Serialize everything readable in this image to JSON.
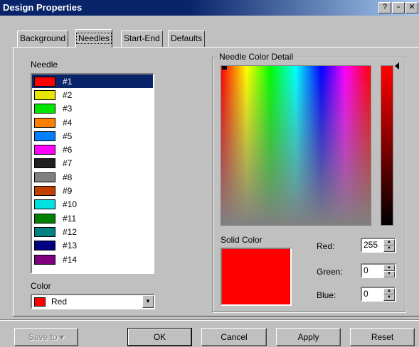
{
  "window": {
    "title": "Design Properties",
    "controls": [
      "help-icon",
      "restore-icon",
      "close-icon"
    ]
  },
  "tabs": [
    {
      "label": "Background"
    },
    {
      "label": "Needles"
    },
    {
      "label": "Start-End"
    },
    {
      "label": "Defaults"
    }
  ],
  "needle_section": {
    "label": "Needle",
    "items": [
      {
        "label": "#1",
        "color": "#ff0000"
      },
      {
        "label": "#2",
        "color": "#e6e600"
      },
      {
        "label": "#3",
        "color": "#00e600"
      },
      {
        "label": "#4",
        "color": "#ff8000"
      },
      {
        "label": "#5",
        "color": "#0080ff"
      },
      {
        "label": "#6",
        "color": "#ff00ff"
      },
      {
        "label": "#7",
        "color": "#202020"
      },
      {
        "label": "#8",
        "color": "#808080"
      },
      {
        "label": "#9",
        "color": "#c04000"
      },
      {
        "label": "#10",
        "color": "#00e0e0"
      },
      {
        "label": "#11",
        "color": "#008000"
      },
      {
        "label": "#12",
        "color": "#008080"
      },
      {
        "label": "#13",
        "color": "#000080"
      },
      {
        "label": "#14",
        "color": "#800080"
      }
    ],
    "selected_index": 0
  },
  "color_section": {
    "label": "Color",
    "selected_value": "Red",
    "selected_color": "#ff0000"
  },
  "detail": {
    "group_title": "Needle Color Detail",
    "solid_label": "Solid Color",
    "solid_color": "#ff0000",
    "red_label": "Red:",
    "red_value": "255",
    "green_label": "Green:",
    "green_value": "0",
    "blue_label": "Blue:",
    "blue_value": "0"
  },
  "buttons": {
    "save_to": "Save to",
    "ok": "OK",
    "cancel": "Cancel",
    "apply": "Apply",
    "reset": "Reset"
  }
}
